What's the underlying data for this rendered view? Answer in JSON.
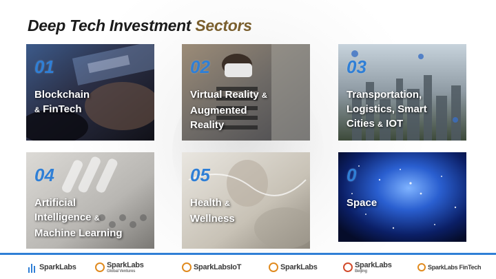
{
  "title": {
    "part1": "Deep Tech Investment",
    "part2": "Sectors"
  },
  "sectors": [
    {
      "num": "01",
      "line1": "Blockchain",
      "line2_small": "&",
      "line2": "FinTech"
    },
    {
      "num": "02",
      "line1": "Virtual Reality",
      "line1_small": "&",
      "line2": "Augmented",
      "line3": "Reality"
    },
    {
      "num": "03",
      "line1": "Transportation,",
      "line2": "Logistics, Smart",
      "line3": "Cities",
      "line3_small": "&",
      "line3_end": "IOT"
    },
    {
      "num": "04",
      "line1": "Artificial",
      "line2": "Intelligence",
      "line2_small": "&",
      "line3": "Machine Learning"
    },
    {
      "num": "05",
      "line1": "Health",
      "line1_small": "&",
      "line2": "Wellness"
    },
    {
      "num": "0",
      "line1": "Space"
    }
  ],
  "logos": [
    {
      "name": "SparkLabs",
      "sub": ""
    },
    {
      "name": "SparkLabs",
      "sub": "Global Ventures"
    },
    {
      "name": "SparkLabsIoT",
      "sub": ""
    },
    {
      "name": "SparkLabs",
      "sub": ""
    },
    {
      "name": "SparkLabs",
      "sub": "Beijing"
    },
    {
      "name": "SparkLabs FinTech",
      "sub": ""
    }
  ],
  "colors": {
    "accent": "#2f7fd6",
    "title_dark": "#1b1b1b",
    "title_gold": "#7a5f2e"
  }
}
